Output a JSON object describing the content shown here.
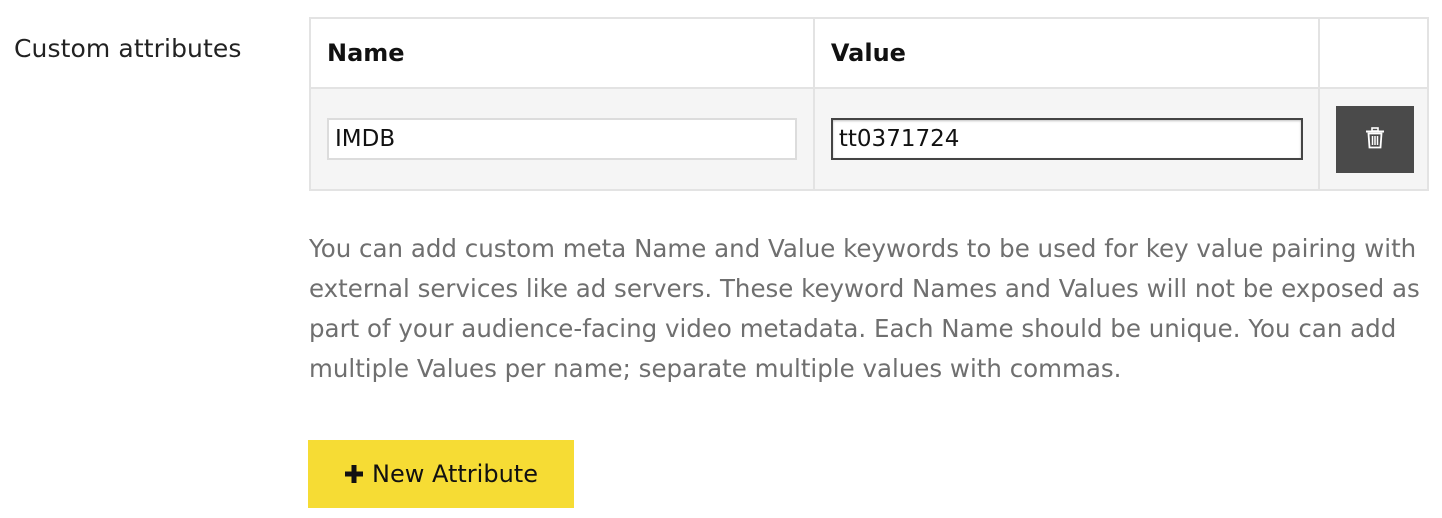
{
  "section_label": "Custom attributes",
  "table": {
    "headers": [
      "Name",
      "Value",
      ""
    ],
    "rows": [
      {
        "name_value": "IMDB",
        "value_value": "tt0371724",
        "delete_icon": "trash-icon"
      }
    ]
  },
  "help_text": "You can add custom meta Name and Value keywords to be used for key value pairing with external services like ad servers. These keyword Names and Values will not be exposed as part of your audience-facing video metadata. Each Name should be unique. You can add multiple Values per name; separate multiple values with commas.",
  "new_attribute_button": {
    "icon": "plus-icon",
    "label": "New Attribute"
  },
  "colors": {
    "button_accent": "#f6dc34",
    "delete_button": "#4a4a4a",
    "help_text": "#6f6f6f"
  }
}
